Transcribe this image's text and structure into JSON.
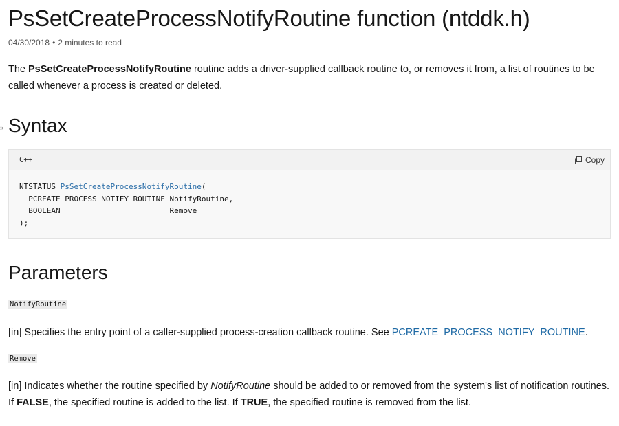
{
  "title": "PsSetCreateProcessNotifyRoutine function (ntddk.h)",
  "meta": {
    "date": "04/30/2018",
    "separator": "•",
    "read_time": "2 minutes to read"
  },
  "intro": {
    "prefix": "The ",
    "bold": "PsSetCreateProcessNotifyRoutine",
    "suffix": " routine adds a driver-supplied callback routine to, or removes it from, a list of routines to be called whenever a process is created or deleted."
  },
  "side_marker": "»",
  "syntax": {
    "heading": "Syntax",
    "language": "C++",
    "copy_label": "Copy",
    "code": {
      "line1_type": "NTSTATUS ",
      "line1_fn": "PsSetCreateProcessNotifyRoutine",
      "line1_paren": "(",
      "line2": "  PCREATE_PROCESS_NOTIFY_ROUTINE NotifyRoutine,",
      "line3": "  BOOLEAN                        Remove",
      "line4": ");"
    }
  },
  "parameters": {
    "heading": "Parameters",
    "notify": {
      "name": "NotifyRoutine",
      "desc_prefix": "[in] Specifies the entry point of a caller-supplied process-creation callback routine. See ",
      "desc_link": "PCREATE_PROCESS_NOTIFY_ROUTINE",
      "desc_suffix": "."
    },
    "remove": {
      "name": "Remove",
      "desc_1": "[in] Indicates whether the routine specified by ",
      "desc_italic": "NotifyRoutine",
      "desc_2": " should be added to or removed from the system's list of notification routines. If ",
      "desc_bold_false": "FALSE",
      "desc_3": ", the specified routine is added to the list. If ",
      "desc_bold_true": "TRUE",
      "desc_4": ", the specified routine is removed from the list."
    }
  },
  "colors": {
    "link": "#1f6aa5",
    "code_function": "#2b6ea8",
    "code_background": "#f8f8f8",
    "inline_code_background": "#eaeaea"
  }
}
